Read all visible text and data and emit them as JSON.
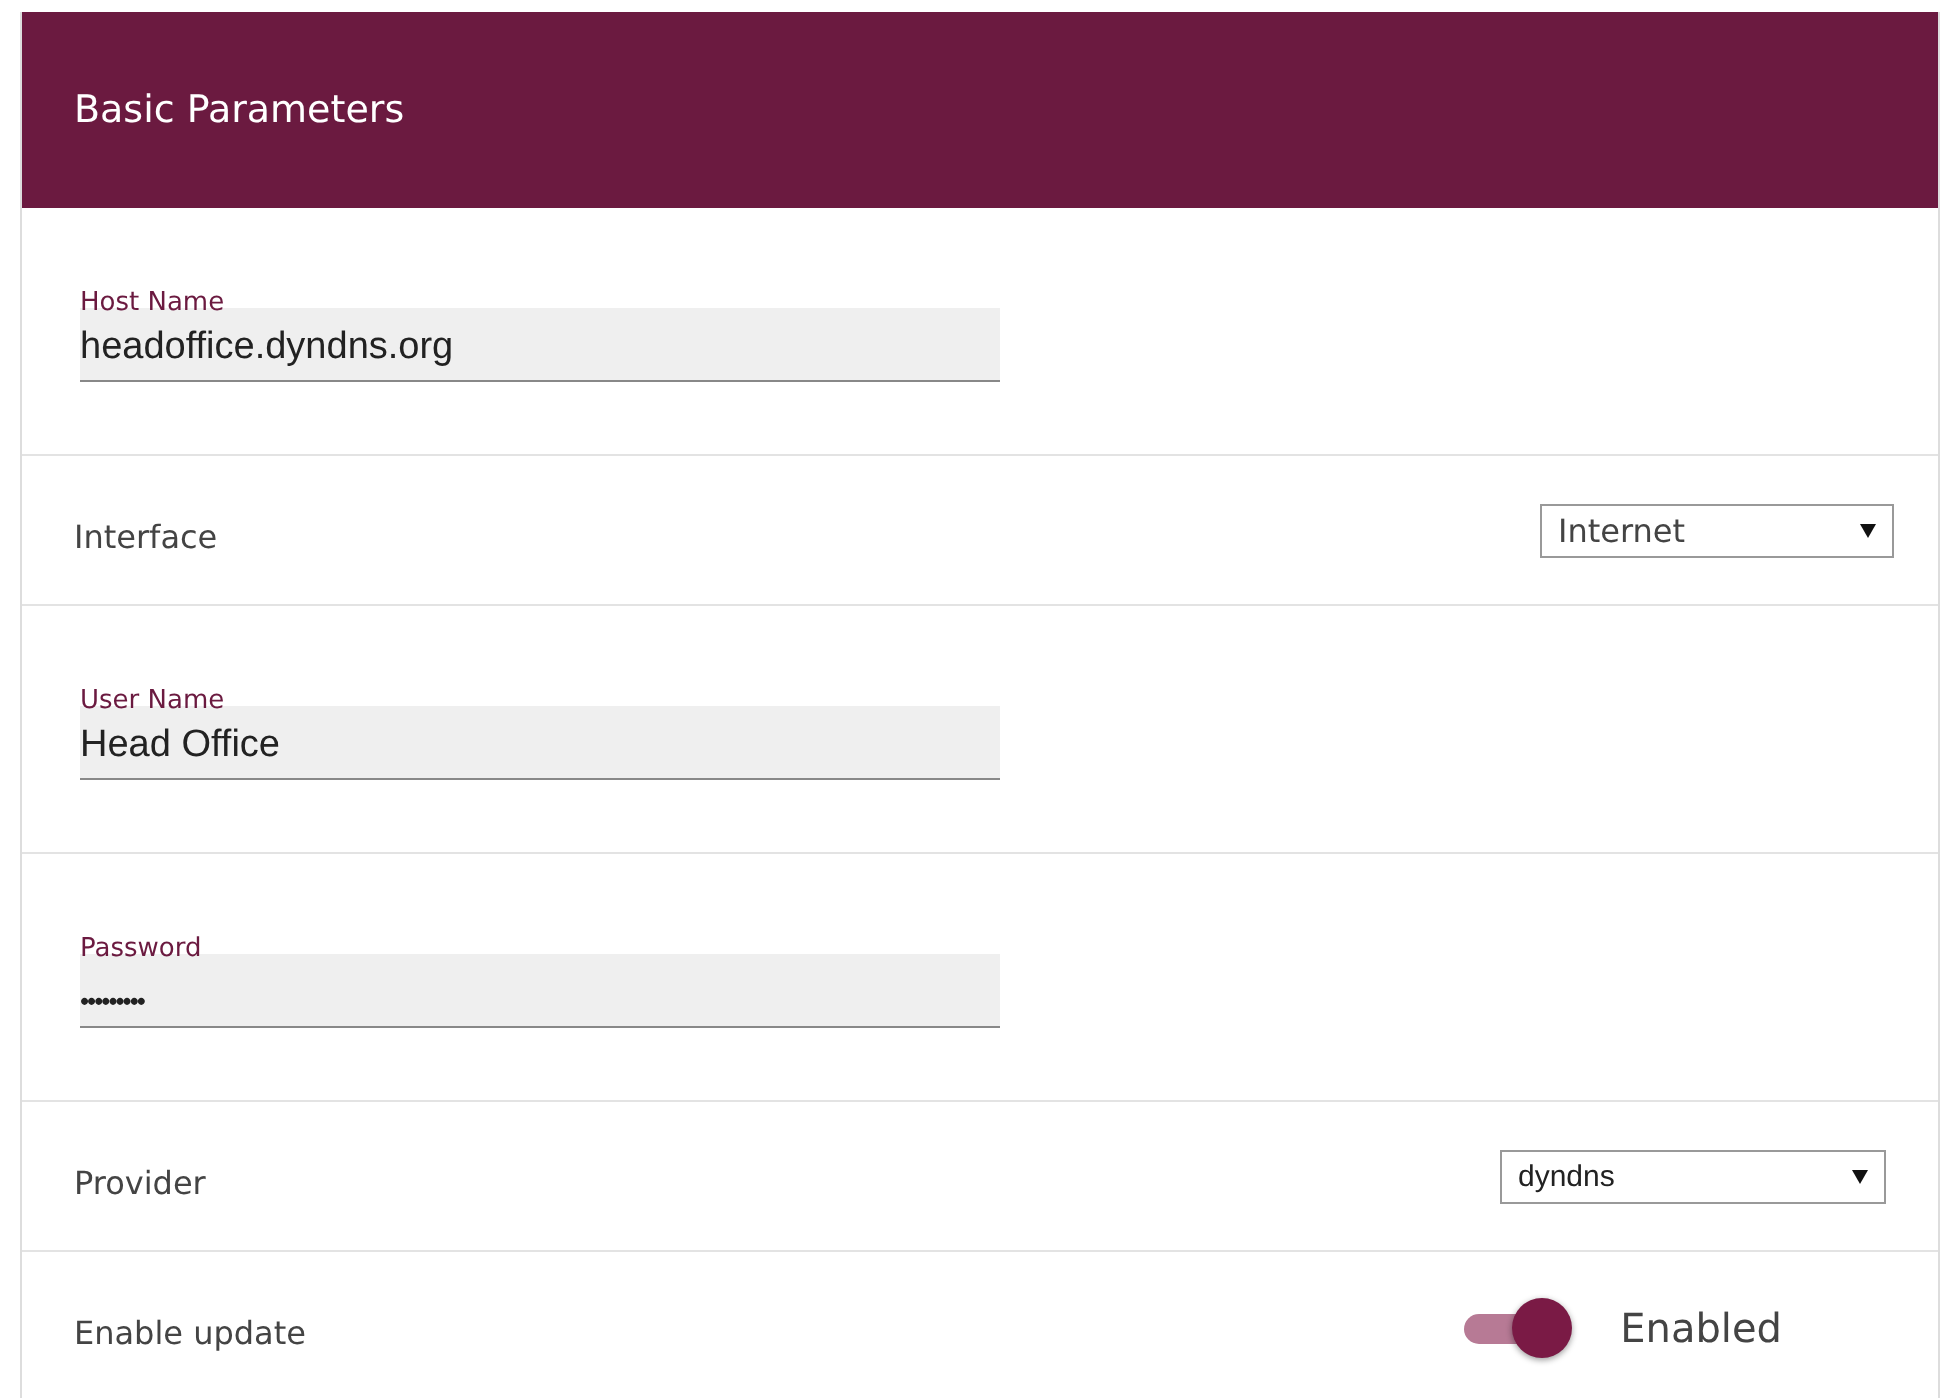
{
  "panel": {
    "title": "Basic Parameters"
  },
  "rows": [
    {
      "kind": "text",
      "label": "Host Name",
      "value": "headoffice.dyndns.org"
    },
    {
      "kind": "select",
      "label": "Interface",
      "value": "Internet"
    },
    {
      "kind": "text",
      "label": "User Name",
      "value": "Head Office"
    },
    {
      "kind": "password",
      "label": "Password",
      "value": "•••••••••"
    },
    {
      "kind": "select",
      "label": "Provider",
      "value": "dyndns"
    },
    {
      "kind": "toggle",
      "label": "Enable update",
      "on": true,
      "state_text": "Enabled"
    }
  ]
}
